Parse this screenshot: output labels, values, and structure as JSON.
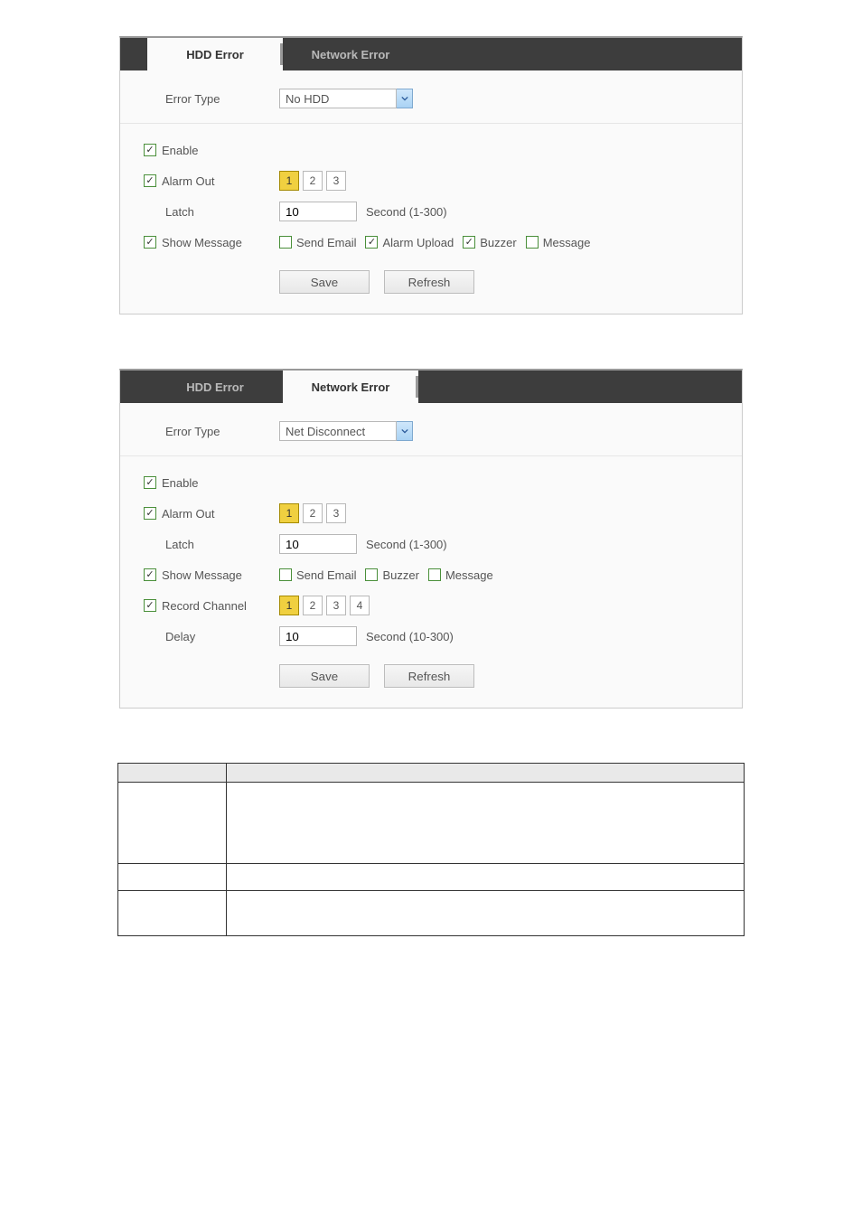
{
  "panel1": {
    "tabs": {
      "hdd": "HDD Error",
      "net": "Network Error"
    },
    "active_tab": "hdd",
    "error_type_label": "Error Type",
    "error_type_value": "No HDD",
    "enable_label": "Enable",
    "enable_checked": true,
    "alarm_out_label": "Alarm Out",
    "alarm_out_checked": true,
    "alarm_channels": [
      "1",
      "2",
      "3"
    ],
    "alarm_selected": "1",
    "latch_label": "Latch",
    "latch_value": "10",
    "latch_hint": "Second (1-300)",
    "show_message_label": "Show Message",
    "show_message_checked": true,
    "send_email_label": "Send Email",
    "send_email_checked": false,
    "alarm_upload_label": "Alarm Upload",
    "alarm_upload_checked": true,
    "buzzer_label": "Buzzer",
    "buzzer_checked": true,
    "message_label": "Message",
    "message_checked": false,
    "save_label": "Save",
    "refresh_label": "Refresh"
  },
  "panel2": {
    "tabs": {
      "hdd": "HDD Error",
      "net": "Network Error"
    },
    "active_tab": "net",
    "error_type_label": "Error Type",
    "error_type_value": "Net Disconnect",
    "enable_label": "Enable",
    "enable_checked": true,
    "alarm_out_label": "Alarm Out",
    "alarm_out_checked": true,
    "alarm_channels": [
      "1",
      "2",
      "3"
    ],
    "alarm_selected": "1",
    "latch_label": "Latch",
    "latch_value": "10",
    "latch_hint": "Second (1-300)",
    "show_message_label": "Show Message",
    "show_message_checked": true,
    "send_email_label": "Send Email",
    "send_email_checked": false,
    "buzzer_label": "Buzzer",
    "buzzer_checked": false,
    "message_label": "Message",
    "message_checked": false,
    "record_channel_label": "Record Channel",
    "record_channel_checked": true,
    "record_channels": [
      "1",
      "2",
      "3",
      "4"
    ],
    "record_selected": "1",
    "delay_label": "Delay",
    "delay_value": "10",
    "delay_hint": "Second (10-300)",
    "save_label": "Save",
    "refresh_label": "Refresh"
  },
  "table": {
    "header_param": "",
    "header_func": "",
    "rows": [
      {
        "param": "",
        "func": ""
      },
      {
        "param": "",
        "func": ""
      },
      {
        "param": "",
        "func": ""
      }
    ]
  }
}
